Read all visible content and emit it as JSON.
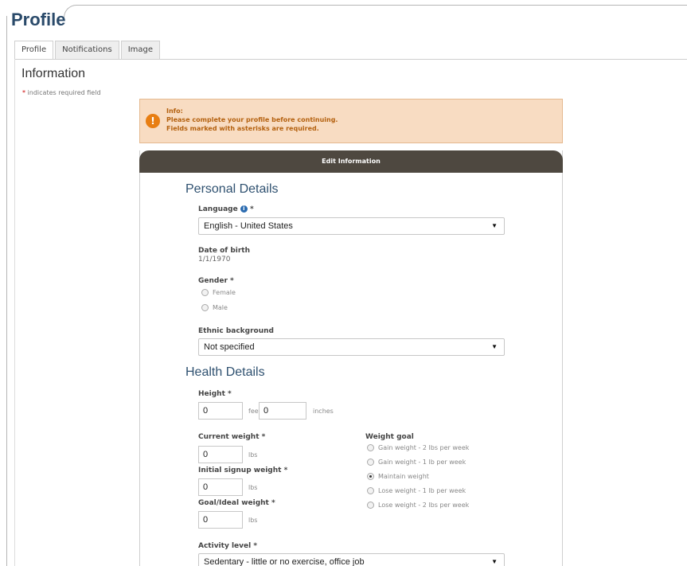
{
  "page": {
    "title": "Profile"
  },
  "tabs": [
    {
      "label": "Profile",
      "active": true
    },
    {
      "label": "Notifications",
      "active": false
    },
    {
      "label": "Image",
      "active": false
    }
  ],
  "section": {
    "title": "Information",
    "required_star": "*",
    "required_note": " indicates required field"
  },
  "info": {
    "heading": "Info:",
    "line1": "Please complete your profile before continuing.",
    "line2": "Fields marked with asterisks are required."
  },
  "panel": {
    "header": "Edit Information"
  },
  "personal": {
    "title": "Personal Details",
    "language": {
      "label": "Language",
      "star": "*",
      "value": "English - United States"
    },
    "dob": {
      "label": "Date of birth",
      "value": "1/1/1970"
    },
    "gender": {
      "label": "Gender *",
      "options": [
        "Female",
        "Male"
      ],
      "selected": null
    },
    "ethnic": {
      "label": "Ethnic background",
      "value": "Not specified"
    }
  },
  "health": {
    "title": "Health Details",
    "height": {
      "label": "Height *",
      "feet": "0",
      "feet_unit": "feet",
      "inches": "0",
      "inches_unit": "inches"
    },
    "current_weight": {
      "label": "Current weight *",
      "value": "0",
      "unit": "lbs"
    },
    "initial_weight": {
      "label": "Initial signup weight *",
      "value": "0",
      "unit": "lbs"
    },
    "goal_weight": {
      "label": "Goal/Ideal weight *",
      "value": "0",
      "unit": "lbs"
    },
    "weight_goal": {
      "label": "Weight goal",
      "options": [
        "Gain weight - 2 lbs per week",
        "Gain weight - 1 lb per week",
        "Maintain weight",
        "Lose weight - 1 lb per week",
        "Lose weight - 2 lbs per week"
      ],
      "selected": "Maintain weight"
    },
    "activity": {
      "label": "Activity level *",
      "value": "Sedentary - little or no exercise, office job"
    }
  },
  "colors": {
    "accent": "#2f5170",
    "header": "#4e4840",
    "info_bg": "#f8dcc2",
    "info_icon": "#e87e12"
  }
}
